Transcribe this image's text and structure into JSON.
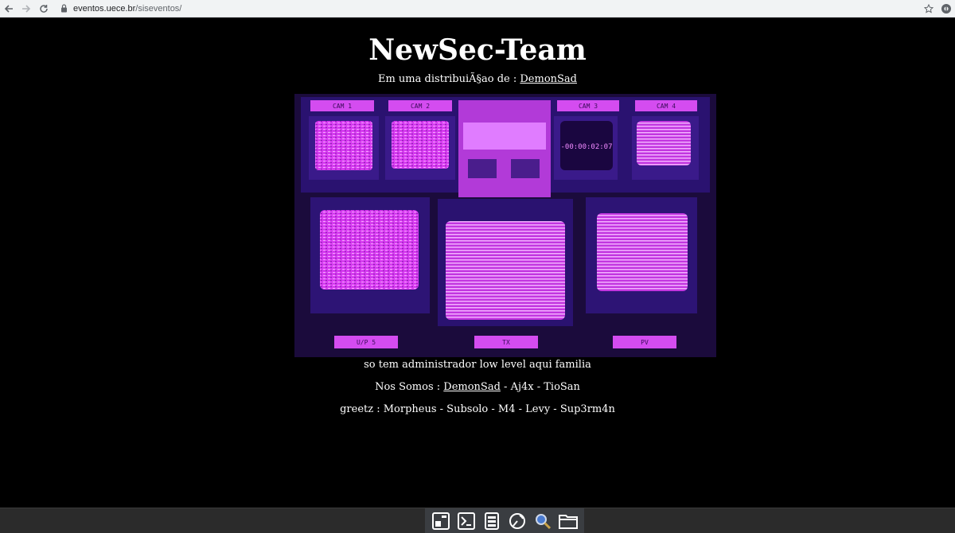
{
  "browser": {
    "url_host": "eventos.uece.br",
    "url_path": "/siseventos/"
  },
  "page": {
    "title": "NewSec-Team",
    "subtitle_prefix": "Em uma distribuiÃ§ao de : ",
    "subtitle_link": "DemonSad",
    "line1": "so tem administrador low level aqui familia",
    "line2_prefix": "Nos Somos : ",
    "line2_link": "DemonSad",
    "line2_suffix": " - Aj4x - TioSan",
    "line3": "greetz : Morpheus - Subsolo - M4 - Levy - Sup3rm4n"
  },
  "image": {
    "cam_labels": [
      "CAM 1",
      "CAM 2",
      "CAM 3",
      "CAM 4"
    ],
    "timer": "-00:00:02:07",
    "bottom_labels": [
      "U/P 5",
      "TX",
      "PV"
    ]
  },
  "taskbar": {
    "icons": [
      "window-manager-icon",
      "terminal-icon",
      "server-icon",
      "gauge-icon",
      "search-icon",
      "folder-icon"
    ]
  },
  "colors": {
    "background": "#000000",
    "text": "#ffffff",
    "monitor_glow": "#e040fb"
  }
}
